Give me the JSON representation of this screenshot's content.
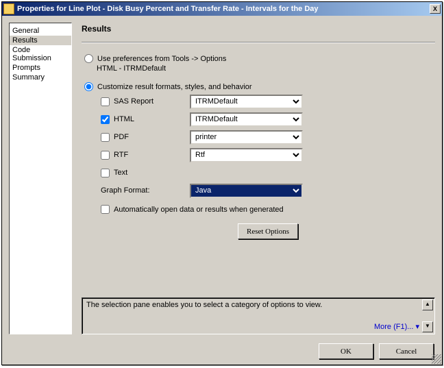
{
  "titlebar": {
    "title": "Properties for Line Plot - Disk Busy Percent and Transfer Rate - Intervals for the Day",
    "close": "X"
  },
  "sidebar": {
    "items": [
      {
        "label": "General",
        "selected": false
      },
      {
        "label": "Results",
        "selected": true
      },
      {
        "label": "Code Submission",
        "selected": false
      },
      {
        "label": "Prompts",
        "selected": false
      },
      {
        "label": "Summary",
        "selected": false
      }
    ]
  },
  "content": {
    "heading": "Results",
    "radio_use_prefs": "Use preferences from Tools -> Options",
    "prefs_sub": "HTML - ITRMDefault",
    "radio_customize": "Customize result formats, styles, and behavior",
    "formats": {
      "sas_report": {
        "label": "SAS Report",
        "checked": false,
        "value": "ITRMDefault"
      },
      "html": {
        "label": "HTML",
        "checked": true,
        "value": "ITRMDefault"
      },
      "pdf": {
        "label": "PDF",
        "checked": false,
        "value": "printer"
      },
      "rtf": {
        "label": "RTF",
        "checked": false,
        "value": "Rtf"
      },
      "text": {
        "label": "Text",
        "checked": false
      }
    },
    "graph_format": {
      "label": "Graph Format:",
      "value": "Java"
    },
    "auto_open": {
      "label": "Automatically open data or results when generated",
      "checked": false
    },
    "reset": "Reset Options",
    "help_text": "The selection pane enables you to select a category of options to view.",
    "more": "More (F1)..."
  },
  "footer": {
    "ok": "OK",
    "cancel": "Cancel"
  }
}
